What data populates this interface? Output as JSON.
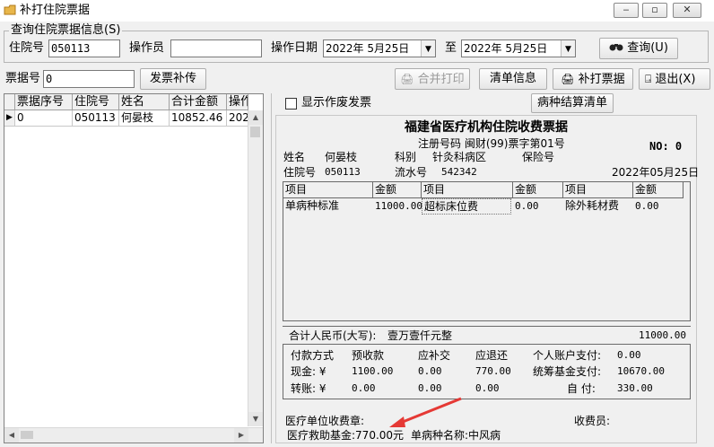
{
  "window": {
    "title": "补打住院票据",
    "btn_min": "‒",
    "btn_max": "▫",
    "btn_close": "✕"
  },
  "query": {
    "group_label": "查询住院票据信息(S)",
    "inpatient_no_label": "住院号",
    "inpatient_no_value": "050113",
    "operator_label": "操作员",
    "operator_value": "",
    "op_date_label": "操作日期",
    "date_from": "2022年  5月25日",
    "to_label": "至",
    "date_to": "2022年  5月25日",
    "query_button": "查询(U)"
  },
  "toolbar": {
    "receipt_no_label": "票据号",
    "receipt_no_value": "0",
    "reissue_button": "发票补传",
    "merge_print_button": "合并打印",
    "list_info_button": "清单信息",
    "reprint_button": "补打票据",
    "exit_button": "退出(X)"
  },
  "grid": {
    "columns": [
      "票据序号",
      "住院号",
      "姓名",
      "合计金额",
      "操作"
    ],
    "rows": [
      {
        "marker": "▶",
        "cells": [
          "0",
          "050113",
          "何晏枝",
          "10852.46",
          "202"
        ]
      }
    ]
  },
  "right_panel": {
    "show_void_checkbox_label": "显示作废发票",
    "show_void_checked": false,
    "disease_settlement_button": "病种结算清单"
  },
  "receipt": {
    "title": "福建省医疗机构住院收费票据",
    "reg_no": "注册号码 闽财(99)票字第01号",
    "no_label": "NO: 0",
    "name_label": "姓名",
    "name_value": "何晏枝",
    "dept_label": "科别",
    "dept_value": "针灸科病区",
    "insurance_label": "保险号",
    "inpatient_no_label": "住院号",
    "inpatient_no_value": "050113",
    "serial_label": "流水号",
    "serial_value": "542342",
    "date": "2022年05月25日",
    "items_headers": [
      "项目",
      "金额",
      "项目",
      "金额",
      "项目",
      "金额"
    ],
    "items_row": [
      "单病种标准",
      "11000.00",
      "超标床位费",
      "0.00",
      "除外耗材费",
      "0.00"
    ],
    "total_label": "合计人民币(大写):",
    "total_words": "壹万壹仟元整",
    "total_value": "11000.00",
    "pay": {
      "method_label": "付款方式",
      "prepaid_label": "预收款",
      "supplement_label": "应补交",
      "refund_label": "应退还",
      "personal_account_label": "个人账户支付:",
      "personal_account_value": "0.00",
      "cash_label": "现金: ¥",
      "cash_prepaid": "1100.00",
      "cash_supplement": "0.00",
      "cash_refund": "770.00",
      "pool_fund_label": "统筹基金支付:",
      "pool_fund_value": "10670.00",
      "transfer_label": "转账: ¥",
      "transfer_prepaid": "0.00",
      "transfer_supplement": "0.00",
      "transfer_refund": "0.00",
      "self_pay_label": "自  付:",
      "self_pay_value": "330.00"
    },
    "stamp_label": "医疗单位收费章:",
    "cashier_label": "收费员:",
    "aid_fund": "医疗救助基金:770.00元",
    "disease_name": "单病种名称:中风病"
  },
  "colors": {
    "annotation_arrow": "#e53935",
    "panel_bg": "#f0f0f0"
  }
}
